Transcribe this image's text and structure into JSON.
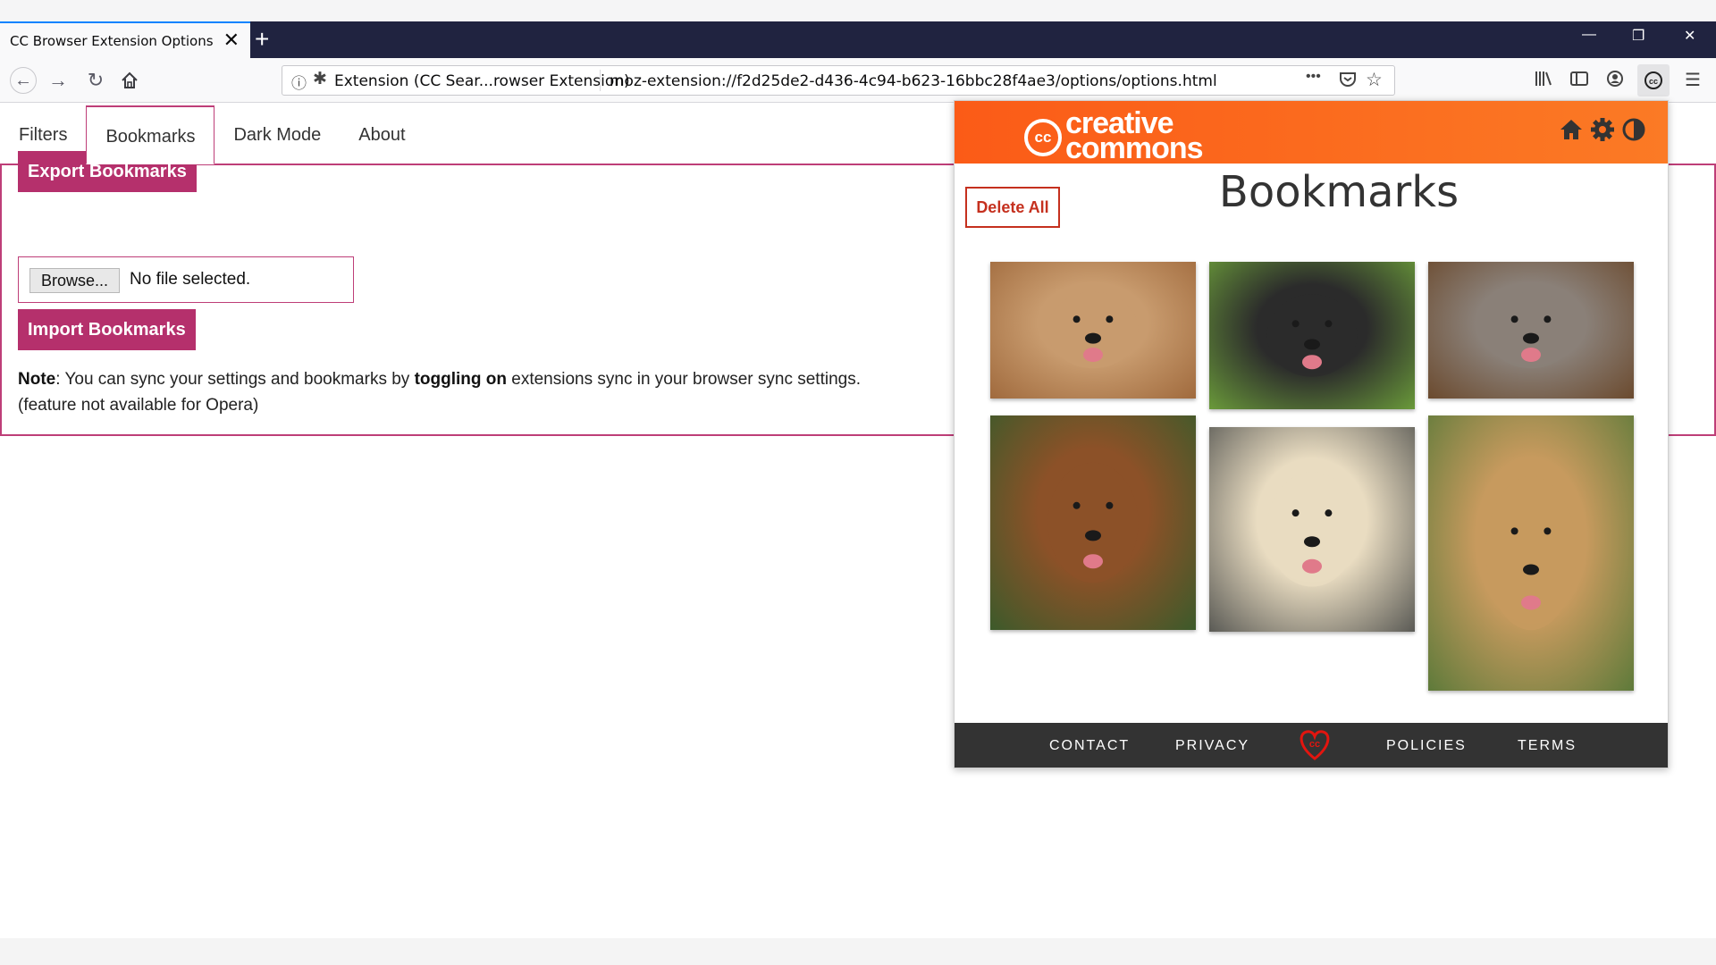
{
  "browser": {
    "tab_title": "CC Browser Extension Options",
    "tab_close": "✕",
    "new_tab": "+",
    "url_identity": "Extension (CC Sear...rowser Extension)",
    "url": "moz-extension://f2d25de2-d436-4c94-b623-16bbc28f4ae3/options/options.html",
    "page_actions": "•••",
    "extension_button": "cc",
    "window_controls": {
      "minimize": "—",
      "restore": "❐",
      "close": "✕"
    }
  },
  "options": {
    "tabs": [
      {
        "label": "Filters",
        "active": false
      },
      {
        "label": "Bookmarks",
        "active": true
      },
      {
        "label": "Dark Mode",
        "active": false
      },
      {
        "label": "About",
        "active": false
      }
    ],
    "export_label": "Export Bookmarks",
    "browse_label": "Browse...",
    "file_status": "No file selected.",
    "import_label": "Import Bookmarks",
    "note": {
      "lead": "Note",
      "text1": ": You can sync your settings and bookmarks by ",
      "bold": "toggling on",
      "text2": " extensions sync in your browser sync settings.",
      "line2": "(feature not available for Opera)"
    }
  },
  "popup": {
    "logo_cc": "cc",
    "logo_word1": "creative",
    "logo_word2": "commons",
    "header_icons": [
      "home-icon",
      "gear-icon",
      "dark-mode-icon"
    ],
    "delete_all_label": "Delete All",
    "title": "Bookmarks",
    "bookmarks": [
      {
        "subject": "curly golden dog",
        "colors": [
          "#c89b6e",
          "#a06a3d"
        ]
      },
      {
        "subject": "black and white spaniel",
        "colors": [
          "#2b2b2b",
          "#6a9a3a"
        ]
      },
      {
        "subject": "tan dog on gravel",
        "colors": [
          "#8a8078",
          "#6b4a2e"
        ]
      },
      {
        "subject": "smiling brown dog",
        "colors": [
          "#8c5128",
          "#3c5a2a"
        ]
      },
      {
        "subject": "golden retriever",
        "colors": [
          "#e9dcc1",
          "#5a5a55"
        ]
      },
      {
        "subject": "tan puppy with stick",
        "colors": [
          "#c79a5e",
          "#5e7a3a"
        ]
      }
    ],
    "footer": {
      "contact": "CONTACT",
      "privacy": "PRIVACY",
      "heart": "cc",
      "policies": "POLICIES",
      "terms": "TERMS"
    },
    "colors": {
      "header_orange": "#fb6a1e",
      "delete_red": "#c5301e",
      "footer_dark": "#333333"
    }
  },
  "colors": {
    "accent_pink": "#b5306c",
    "tab_border": "#be3e78",
    "tabbar_dark": "#202340"
  }
}
